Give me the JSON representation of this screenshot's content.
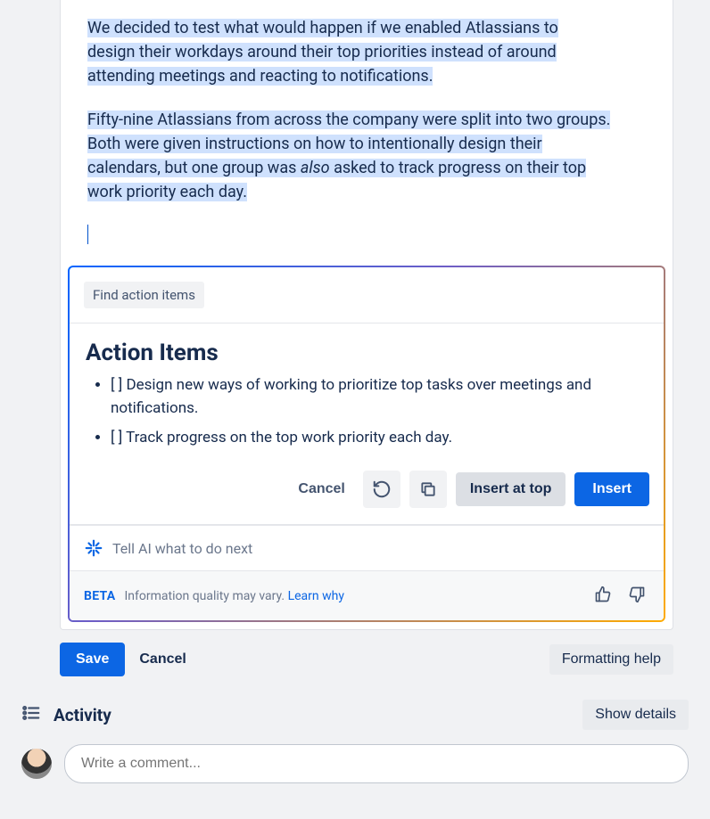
{
  "content": {
    "paragraph1_chunks": [
      "We decided to test what would happen if we enabled Atlassians to",
      "design their workdays around their top priorities instead of around",
      "attending meetings and reacting to notifications."
    ],
    "paragraph2_pre_em_chunks": [
      "Fifty-nine Atlassians from across the company were split into two groups.",
      "Both were given instructions on how to intentionally design their",
      "calendars, but one group was "
    ],
    "paragraph2_em": "also",
    "paragraph2_post_em_chunks": [
      " asked to track progress on their top",
      "work priority each day."
    ]
  },
  "ai_panel": {
    "chip": "Find action items",
    "title": "Action Items",
    "items": [
      "[ ] Design new ways of working to prioritize top tasks over meetings and notifications.",
      "[ ] Track progress on the top work priority each day."
    ],
    "cancel": "Cancel",
    "insert_top": "Insert at top",
    "insert": "Insert",
    "prompt_placeholder": "Tell AI what to do next",
    "beta": "BETA",
    "info": "Information quality may vary.",
    "learn": "Learn why"
  },
  "editor_actions": {
    "save": "Save",
    "cancel": "Cancel",
    "formatting_help": "Formatting help"
  },
  "activity": {
    "title": "Activity",
    "show_details": "Show details",
    "comment_placeholder": "Write a comment..."
  }
}
